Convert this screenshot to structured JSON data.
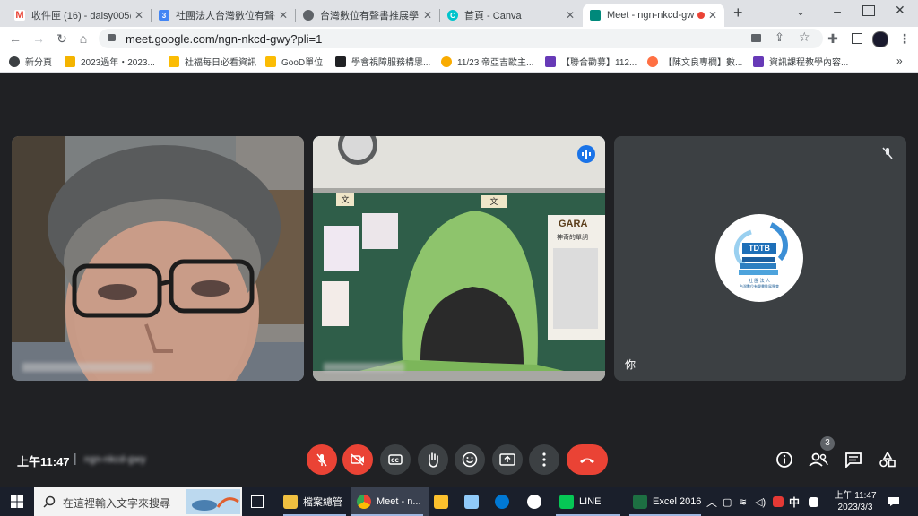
{
  "browser": {
    "tabs": [
      {
        "title": "收件匣 (16) - daisy005@",
        "icon": "gmail-icon",
        "color": "#ea4335",
        "active": false
      },
      {
        "title": "社團法人台灣數位有聲書",
        "icon": "calendar-icon",
        "color": "#4285f4",
        "active": false
      },
      {
        "title": "台灣數位有聲書推展學會",
        "icon": "globe-icon",
        "color": "#5f6368",
        "active": false
      },
      {
        "title": "首頁 - Canva",
        "icon": "canva-icon",
        "color": "#00c4cc",
        "active": false
      },
      {
        "title": "Meet - ngn-nkcd-gw",
        "icon": "meet-icon",
        "color": "#00897b",
        "active": true
      }
    ],
    "new_tab_label": "+",
    "url": "meet.google.com/ngn-nkcd-gwy?pli=1",
    "bookmarks": [
      {
        "label": "新分頁",
        "color": "#5f6368"
      },
      {
        "label": "2023過年・2023...",
        "color": "#f4b400"
      },
      {
        "label": "社福每日必看資訊",
        "color": "#fbbc04"
      },
      {
        "label": "GooD單位",
        "color": "#fbbc04"
      },
      {
        "label": "學會視障服務構思...",
        "color": "#202124"
      },
      {
        "label": "11/23 帝亞吉歐主...",
        "color": "#f9ab00"
      },
      {
        "label": "【聯合勸募】112...",
        "color": "#673ab7"
      },
      {
        "label": "【陳文良專欄】數...",
        "color": "#ff7043"
      },
      {
        "label": "資訊課程教學內容...",
        "color": "#673ab7"
      }
    ],
    "bookmarks_more": "»"
  },
  "meet": {
    "tiles": [
      {
        "name": "",
        "kind": "camera-man"
      },
      {
        "name": "",
        "kind": "camera-classroom",
        "speaking": true
      },
      {
        "name": "你",
        "kind": "avatar"
      }
    ],
    "classroom_signs": [
      "文",
      "文",
      "GARA",
      "神奇的單詞"
    ],
    "logo_text": "TDTB",
    "logo_subtitle1": "社 團 法 人",
    "logo_subtitle2": "台灣數位有聲書推展學會",
    "time": "上午11:47",
    "divider": "|",
    "meeting_code": "ngn-nkcd-gwy",
    "participants_count": "3",
    "accent": "#8ab4f8",
    "danger": "#ea4335"
  },
  "taskbar": {
    "search_placeholder": "在這裡輸入文字來搜尋",
    "apps": [
      {
        "label": "檔案總管",
        "color": "#f0c040"
      },
      {
        "label": "Meet - n...",
        "color": "#4285f4"
      },
      {
        "label": "",
        "color": "#fbc02d"
      },
      {
        "label": "",
        "color": "#90caf9"
      },
      {
        "label": "",
        "color": "#0078d4"
      },
      {
        "label": "",
        "color": "#ffffff"
      },
      {
        "label": "LINE",
        "color": "#06c755"
      },
      {
        "label": "Excel 2016",
        "color": "#1d6f42"
      }
    ],
    "ime": "中",
    "clock_time": "上午 11:47",
    "clock_date": "2023/3/3"
  }
}
